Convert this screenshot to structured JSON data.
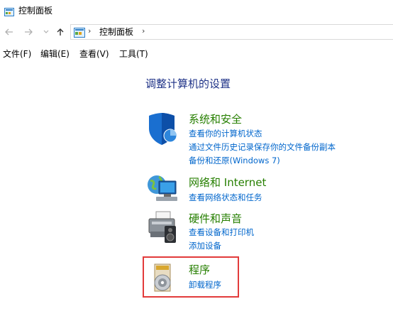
{
  "window": {
    "title": "控制面板"
  },
  "nav": {
    "address_path": "控制面板",
    "separator": "›"
  },
  "menu": {
    "file": "文件(F)",
    "edit": "编辑(E)",
    "view": "查看(V)",
    "tools": "工具(T)"
  },
  "main": {
    "heading": "调整计算机的设置",
    "categories": [
      {
        "title": "系统和安全",
        "icon": "shield-icon",
        "links": [
          "查看你的计算机状态",
          "通过文件历史记录保存你的文件备份副本",
          "备份和还原(Windows 7)"
        ]
      },
      {
        "title": "网络和 Internet",
        "icon": "network-globe-icon",
        "links": [
          "查看网络状态和任务"
        ]
      },
      {
        "title": "硬件和声音",
        "icon": "printer-speaker-icon",
        "links": [
          "查看设备和打印机",
          "添加设备"
        ]
      },
      {
        "title": "程序",
        "icon": "programs-disc-icon",
        "links": [
          "卸载程序"
        ]
      }
    ]
  },
  "colors": {
    "category_title": "#267f00",
    "link": "#0066cc",
    "heading": "#1e3287",
    "highlight": "#e23b3b"
  }
}
